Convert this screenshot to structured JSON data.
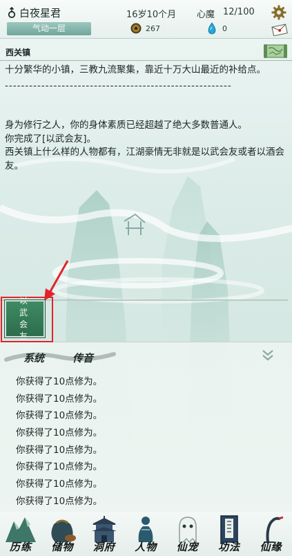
{
  "header": {
    "player_name": "白夜星君",
    "realm": "气动一层",
    "age": "16岁10个月",
    "demon_label": "心魔",
    "demon_value": "12/100",
    "coins": "267",
    "gems": "0"
  },
  "location": {
    "name": "西关镇",
    "description": "十分繁华的小镇，三教九流聚集，靠近十万大山最近的补给点。",
    "divider": "--------------------------------------------------------",
    "events": [
      "身为修行之人，你的身体素质已经超越了绝大多数普通人。",
      "你完成了[以武会友]。",
      "西关镇上什么样的人物都有，江湖豪情无非就是以武会友或者以酒会友。"
    ]
  },
  "action": {
    "label": "以武会友"
  },
  "log": {
    "tabs": [
      "系统",
      "传音"
    ],
    "entries": [
      "你获得了10点修为。",
      "你获得了10点修为。",
      "你获得了10点修为。",
      "你获得了10点修为。",
      "你获得了10点修为。",
      "你获得了10点修为。",
      "你获得了10点修为。",
      "你获得了10点修为。"
    ]
  },
  "nav": {
    "items": [
      "历练",
      "储物",
      "洞府",
      "人物",
      "仙宠",
      "功法",
      "仙缘"
    ]
  },
  "icons": {
    "gender": "male-icon",
    "coin": "coin-icon",
    "gem": "gem-icon",
    "settings": "gear-icon",
    "mail": "mail-icon",
    "map": "map-scroll-icon",
    "collapse": "chevron-double-down-icon"
  },
  "colors": {
    "accent": "#3f8a64",
    "highlight_frame": "#e0242a",
    "realm_badge": "#7fb1a7",
    "gem": "#27a6d9",
    "coin": "#8a6a1e"
  }
}
